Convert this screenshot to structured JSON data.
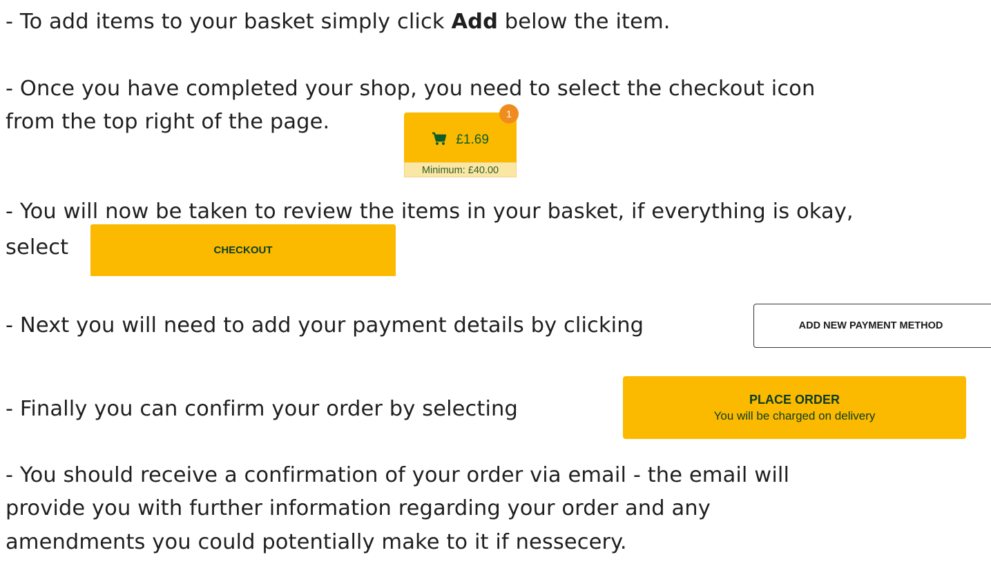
{
  "instructions": {
    "step1_prefix": "-  To add items to your basket simply click ",
    "step1_bold": "Add",
    "step1_suffix": " below the item.",
    "step2_line1": "-  Once you have completed your shop, you need to select the checkout icon",
    "step2_line2": "from the top right of the page.",
    "step3_line1": "-  You will now be taken to review the items in your basket, if everything is okay,",
    "step3_line2": "select",
    "step4": "-  Next you will need to add your payment details by clicking",
    "step5": "-  Finally you can confirm your order by selecting",
    "step6_line1": "-  You should receive a confirmation of your order via email - the email will",
    "step6_line2": "provide you with further information regarding your order and any",
    "step6_line3": "amendments you could potentially make to it if nessecery."
  },
  "basket": {
    "total": "£1.69",
    "item_count": "1",
    "minimum": "Minimum: £40.00",
    "icon": "cart-icon"
  },
  "buttons": {
    "checkout": "CHECKOUT",
    "add_payment": "ADD NEW PAYMENT METHOD",
    "place_order": "PLACE ORDER",
    "place_order_sub": "You will be charged on delivery"
  },
  "colors": {
    "accent_yellow": "#fbb900",
    "badge_orange": "#f08c1e",
    "button_text_green": "#0b3d22"
  }
}
